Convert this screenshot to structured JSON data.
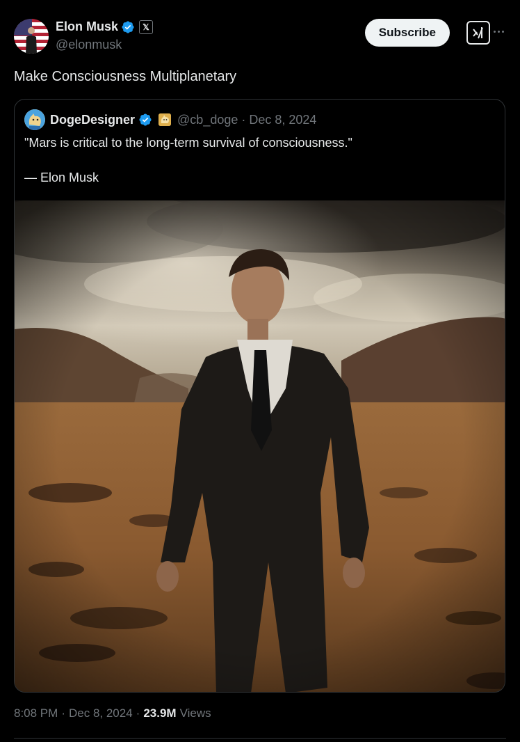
{
  "author": {
    "name": "Elon Musk",
    "handle": "@elonmusk",
    "verified_icon": "verified-badge-icon",
    "affiliate_badge": "𝕏"
  },
  "actions": {
    "subscribe_label": "Subscribe",
    "grok_icon": "grok-icon",
    "more_icon": "more-options-icon"
  },
  "tweet": {
    "text": "Make Consciousness Multiplanetary"
  },
  "quote": {
    "name": "DogeDesigner",
    "handle": "@cb_doge",
    "separator": "·",
    "date": "Dec 8, 2024",
    "text": "\"Mars is critical to the long-term survival of consciousness.\"",
    "attribution": "— Elon Musk"
  },
  "meta": {
    "time": "8:08 PM",
    "separator1": "·",
    "date": "Dec 8, 2024",
    "separator2": "·",
    "views_count": "23.9M",
    "views_label": "Views"
  },
  "colors": {
    "background": "#000000",
    "text": "#e7e9ea",
    "muted": "#71767b",
    "verified": "#1d9bf0",
    "border": "#2f3336"
  }
}
